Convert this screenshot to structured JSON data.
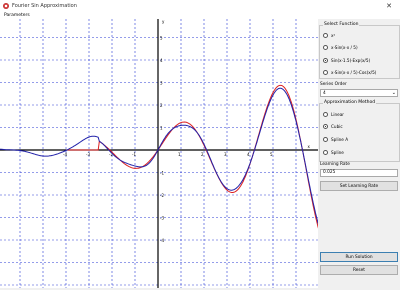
{
  "window": {
    "title": "Fourier Sin Approximation",
    "close_label": "✕"
  },
  "menu": {
    "items": [
      "Parameters"
    ]
  },
  "plot": {
    "x_ticks": [
      "-4",
      "-3",
      "-2",
      "-1",
      "1",
      "2",
      "3",
      "4",
      "5"
    ],
    "y_ticks": [
      "5",
      "4",
      "3",
      "2",
      "1",
      "-1",
      "-2",
      "-3",
      "-4"
    ],
    "x_axis_label": "x",
    "y_axis_label": "y",
    "colors": {
      "target": "#dd2222",
      "approx": "#2222aa",
      "grid": "#2a3bd6"
    }
  },
  "panel": {
    "function_group": {
      "legend": "Select Function",
      "options": [
        {
          "label": "x²",
          "selected": false
        },
        {
          "label": "x·Sin(x·x / 5)",
          "selected": false
        },
        {
          "label": "Sin(x·1.5)·Exp(x/5)",
          "selected": true
        },
        {
          "label": "x·Sin(x·x / 5)·Cos(x/5)",
          "selected": false
        }
      ]
    },
    "order_label": "Series Order",
    "order_value": "4",
    "approx_group": {
      "legend": "Approximation Method",
      "options": [
        {
          "label": "Linear",
          "selected": false
        },
        {
          "label": "Cubic",
          "selected": true
        },
        {
          "label": "Spline A",
          "selected": false
        },
        {
          "label": "Spline",
          "selected": false
        }
      ]
    },
    "step_label": "Learning Rate",
    "step_value": "0.025",
    "set_button": "Set Learning Rate",
    "run_button": "Run Solution",
    "reset_button": "Reset"
  }
}
